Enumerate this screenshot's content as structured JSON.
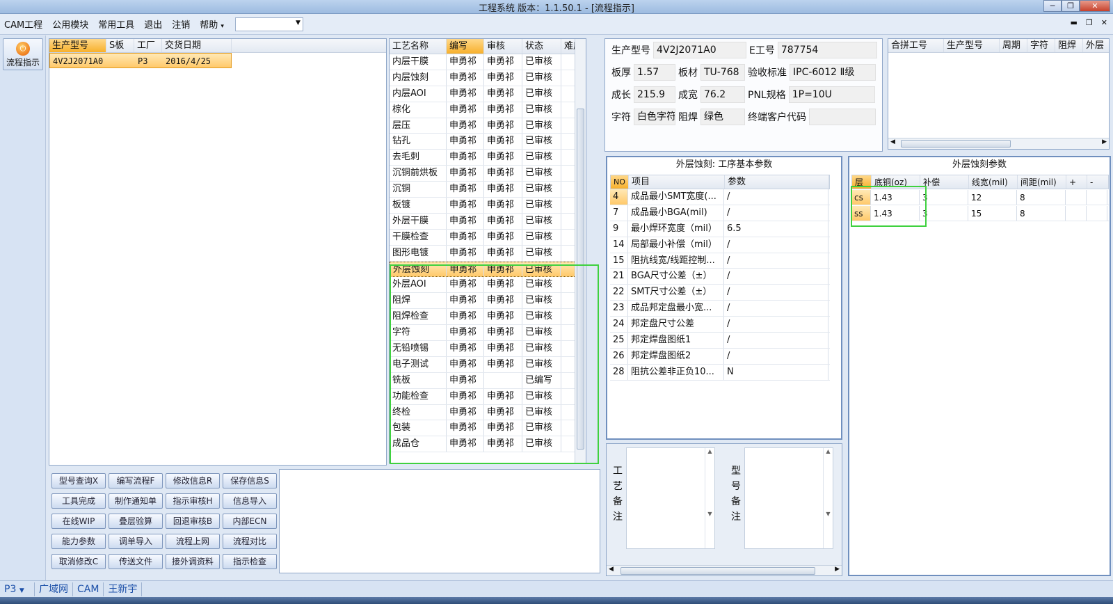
{
  "window": {
    "title": "工程系统   版本：1.1.50.1 - [流程指示]"
  },
  "menu": {
    "items": [
      "CAM工程",
      "公用模块",
      "常用工具",
      "退出",
      "注销",
      "帮助"
    ],
    "help_dd": "▾",
    "combo_value": ""
  },
  "sidebar": {
    "flow_button": "流程指示"
  },
  "orders": {
    "headers": [
      "生产型号",
      "S板",
      "工厂",
      "交货日期"
    ],
    "rows": [
      [
        "4V2J2071A0",
        "",
        "P3",
        "2016/4/25"
      ]
    ]
  },
  "process": {
    "headers": [
      "工艺名称",
      "编写",
      "审核",
      "状态",
      "难度"
    ],
    "rows": [
      [
        "内层干膜",
        "申勇祁",
        "申勇祁",
        "已审核",
        ""
      ],
      [
        "内层蚀刻",
        "申勇祁",
        "申勇祁",
        "已审核",
        ""
      ],
      [
        "内层AOI",
        "申勇祁",
        "申勇祁",
        "已审核",
        ""
      ],
      [
        "棕化",
        "申勇祁",
        "申勇祁",
        "已审核",
        ""
      ],
      [
        "层压",
        "申勇祁",
        "申勇祁",
        "已审核",
        ""
      ],
      [
        "钻孔",
        "申勇祁",
        "申勇祁",
        "已审核",
        ""
      ],
      [
        "去毛刺",
        "申勇祁",
        "申勇祁",
        "已审核",
        ""
      ],
      [
        "沉铜前烘板",
        "申勇祁",
        "申勇祁",
        "已审核",
        ""
      ],
      [
        "沉铜",
        "申勇祁",
        "申勇祁",
        "已审核",
        ""
      ],
      [
        "板镀",
        "申勇祁",
        "申勇祁",
        "已审核",
        ""
      ],
      [
        "外层干膜",
        "申勇祁",
        "申勇祁",
        "已审核",
        ""
      ],
      [
        "干膜检查",
        "申勇祁",
        "申勇祁",
        "已审核",
        ""
      ],
      [
        "图形电镀",
        "申勇祁",
        "申勇祁",
        "已审核",
        ""
      ],
      [
        "外层蚀刻",
        "申勇祁",
        "申勇祁",
        "已审核",
        ""
      ],
      [
        "外层AOI",
        "申勇祁",
        "申勇祁",
        "已审核",
        ""
      ],
      [
        "阻焊",
        "申勇祁",
        "申勇祁",
        "已审核",
        ""
      ],
      [
        "阻焊检查",
        "申勇祁",
        "申勇祁",
        "已审核",
        ""
      ],
      [
        "字符",
        "申勇祁",
        "申勇祁",
        "已审核",
        ""
      ],
      [
        "无铅喷锡",
        "申勇祁",
        "申勇祁",
        "已审核",
        ""
      ],
      [
        "电子测试",
        "申勇祁",
        "申勇祁",
        "已审核",
        ""
      ],
      [
        "铣板",
        "申勇祁",
        "",
        "已编写",
        ""
      ],
      [
        "功能检查",
        "申勇祁",
        "申勇祁",
        "已审核",
        ""
      ],
      [
        "终检",
        "申勇祁",
        "申勇祁",
        "已审核",
        ""
      ],
      [
        "包装",
        "申勇祁",
        "申勇祁",
        "已审核",
        ""
      ],
      [
        "成品仓",
        "申勇祁",
        "申勇祁",
        "已审核",
        ""
      ]
    ],
    "selected_index": 13
  },
  "info": {
    "model_label": "生产型号",
    "model_value": "4V2J2071A0",
    "eno_label": "E工号",
    "eno_value": "787754",
    "thick_label": "板厚",
    "thick_value": "1.57",
    "mat_label": "板材",
    "mat_value": "TU-768",
    "std_label": "验收标准",
    "std_value": "IPC-6012 Ⅱ级",
    "len_label": "成长",
    "len_value": "215.9",
    "wid_label": "成宽",
    "wid_value": "76.2",
    "pnl_label": "PNL规格",
    "pnl_value": "1P=10U",
    "char_label": "字符",
    "char_value": "白色字符",
    "mask_label": "阻焊",
    "mask_value": "绿色",
    "cust_label": "终端客户代码",
    "cust_value": ""
  },
  "merge": {
    "headers": [
      "合拼工号",
      "生产型号",
      "周期",
      "字符",
      "阻焊",
      "外层"
    ]
  },
  "params": {
    "title": "外层蚀刻: 工序基本参数",
    "headers": [
      "NO",
      "项目",
      "参数"
    ],
    "rows": [
      [
        "4",
        "成品最小SMT宽度(...",
        "/"
      ],
      [
        "7",
        "成品最小BGA(mil)",
        "/"
      ],
      [
        "9",
        "最小焊环宽度（mil）",
        "6.5"
      ],
      [
        "14",
        "局部最小补偿（mil）",
        "/"
      ],
      [
        "15",
        "阻抗线宽/线距控制...",
        "/"
      ],
      [
        "21",
        "BGA尺寸公差（±）",
        "/"
      ],
      [
        "22",
        "SMT尺寸公差（±）",
        "/"
      ],
      [
        "23",
        "成品邦定盘最小宽...",
        "/"
      ],
      [
        "24",
        "邦定盘尺寸公差",
        "/"
      ],
      [
        "25",
        "邦定焊盘图纸1",
        "/"
      ],
      [
        "26",
        "邦定焊盘图纸2",
        "/"
      ],
      [
        "28",
        "阻抗公差非正负10...",
        "N"
      ]
    ]
  },
  "etch": {
    "title": "外层蚀刻参数",
    "headers": [
      "层",
      "底铜(oz)",
      "补偿",
      "线宽(mil)",
      "间距(mil)",
      "+",
      "-"
    ],
    "rows": [
      [
        "cs",
        "1.43",
        "3",
        "12",
        "8",
        "",
        ""
      ],
      [
        "ss",
        "1.43",
        "3",
        "15",
        "8",
        "",
        ""
      ]
    ]
  },
  "remarks": {
    "process_label": "工艺备注",
    "model_label": "型号备注"
  },
  "buttons": [
    "型号查询X",
    "编写流程F",
    "修改信息R",
    "保存信息S",
    "工具完成",
    "制作通知单",
    "指示审核H",
    "信息导入",
    "在线WIP",
    "叠层验算",
    "回退审核B",
    "内部ECN",
    "能力参数",
    "调单导入",
    "流程上网",
    "流程对比",
    "取消修改C",
    "传送文件",
    "接外调资料",
    "指示检查"
  ],
  "status": {
    "plant": "P3",
    "network": "广域网",
    "dept": "CAM",
    "user": "王新宇"
  },
  "colors": {
    "highlight": "#ffc96a",
    "green_box": "#3fd13f",
    "window_bg": "#dfe8f4"
  }
}
